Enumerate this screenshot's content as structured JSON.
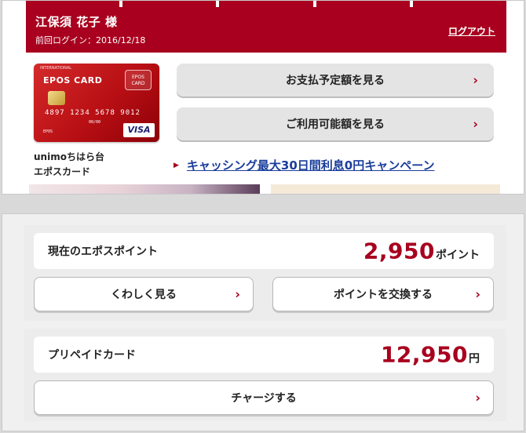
{
  "header": {
    "user_name": "江保須 花子 様",
    "last_login": "前回ログイン：2016/12/18",
    "logout_label": "ログアウト"
  },
  "card": {
    "brand_text": "EPOS CARD",
    "emblem_text": "EPOS CARD",
    "international_text": "INTERNATIONAL",
    "numbers_text": "4897 1234 5678 9012",
    "valid_text": "00/00",
    "holder_text": "EPOS",
    "visa_text": "VISA",
    "name_line1": "unimoちはら台",
    "name_line2": "エポスカード"
  },
  "actions": {
    "payment_label": "お支払予定額を見る",
    "available_label": "ご利用可能額を見る",
    "chevron": "›"
  },
  "campaign": {
    "marker": "▶",
    "text": "キャッシング最大30日間利息0円キャンペーン"
  },
  "points": {
    "label": "現在のエポスポイント",
    "value": "2,950",
    "unit": "ポイント",
    "details_label": "くわしく見る",
    "exchange_label": "ポイントを交換する"
  },
  "prepaid": {
    "label": "プリペイドカード",
    "value": "12,950",
    "unit": "円",
    "charge_label": "チャージする"
  },
  "colors": {
    "brand_red": "#a8001e",
    "link_blue": "#1b3e9b"
  }
}
